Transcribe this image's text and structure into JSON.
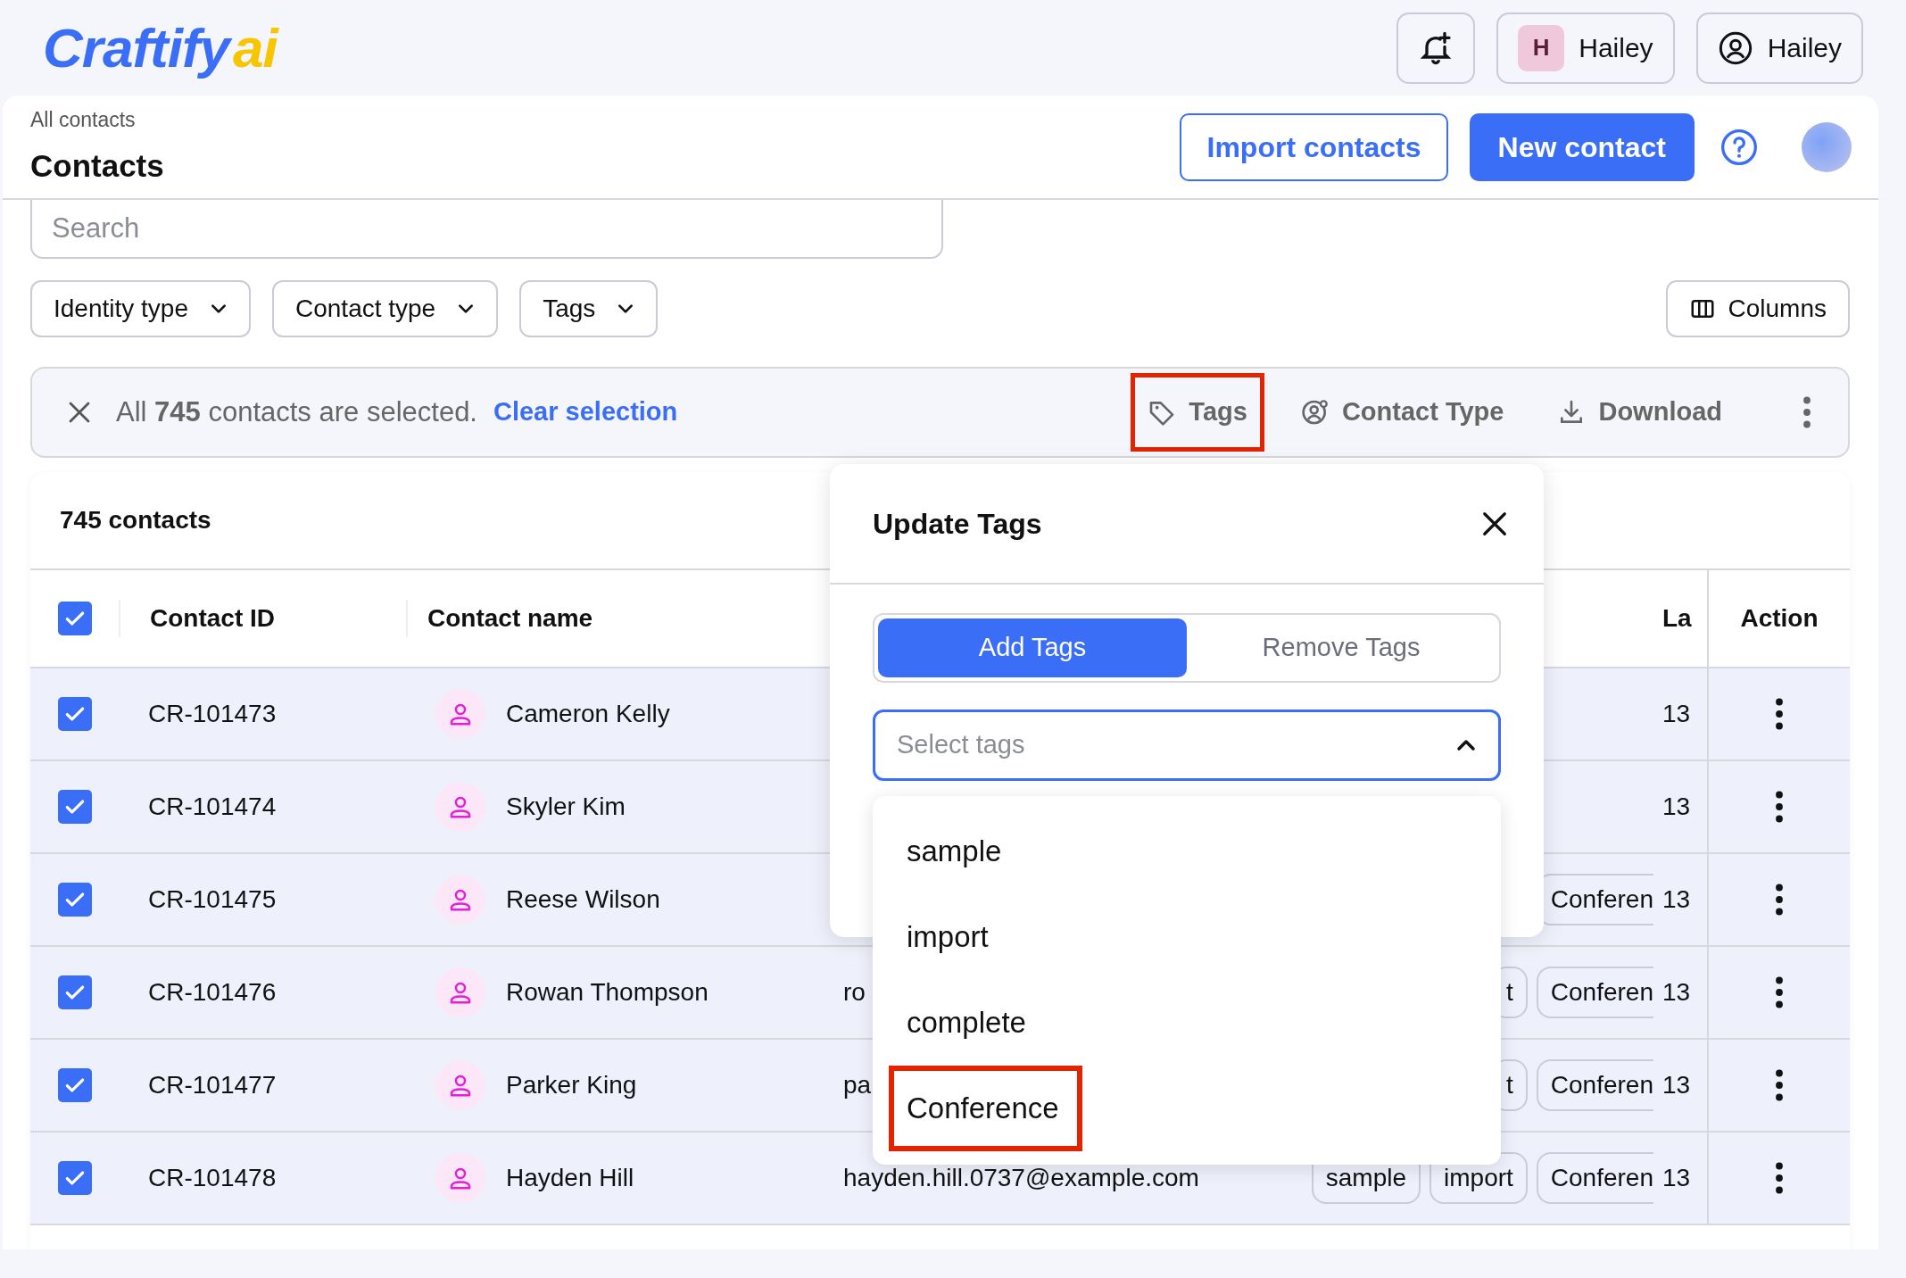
{
  "brand": {
    "name": "Craftify",
    "suffix": "ai"
  },
  "topbar": {
    "user_chip": {
      "initial": "H",
      "name": "Hailey"
    },
    "account": {
      "name": "Hailey"
    }
  },
  "header": {
    "breadcrumb": "All contacts",
    "title": "Contacts",
    "buttons": [
      {
        "label": "Import contacts",
        "kind": "outline"
      },
      {
        "label": "New contact",
        "kind": "primary"
      }
    ]
  },
  "search": {
    "placeholder": "Search"
  },
  "filters": [
    "Identity type",
    "Contact type",
    "Tags"
  ],
  "columns_button": "Columns",
  "selection_bar": {
    "text": "All **745** contacts are selected.",
    "link": "Clear selection",
    "actions": [
      {
        "label": "Tags",
        "kind": "tag",
        "highlighted": true
      },
      {
        "label": "Contact Type",
        "kind": "usergear",
        "highlighted": false
      },
      {
        "label": "Download",
        "kind": "download",
        "highlighted": false
      }
    ]
  },
  "table": {
    "title": "745 contacts",
    "all_checked": true,
    "columns": [
      "Contact ID",
      "Contact name",
      "La",
      "Action"
    ],
    "rows": [
      {
        "checked": true,
        "id": "CR-101473",
        "name": "Cameron Kelly",
        "last": "13"
      },
      {
        "checked": true,
        "id": "CR-101474",
        "name": "Skyler Kim",
        "last": "13"
      },
      {
        "checked": true,
        "id": "CR-101475",
        "name": "Reese Wilson",
        "tags": [
          "Conferen"
        ],
        "last": "13"
      },
      {
        "checked": true,
        "id": "CR-101476",
        "name": "Rowan Thompson",
        "email": "ro",
        "tags": [
          "t",
          "Conferen"
        ],
        "last": "13"
      },
      {
        "checked": true,
        "id": "CR-101477",
        "name": "Parker King",
        "email": "pa",
        "tags": [
          "t",
          "Conferen"
        ],
        "last": "13"
      },
      {
        "checked": true,
        "id": "CR-101478",
        "name": "Hayden Hill",
        "email": "hayden.hill.0737@example.com",
        "tags": [
          "sample",
          "import",
          "Conferen"
        ],
        "last": "13"
      }
    ]
  },
  "popover": {
    "title": "Update Tags",
    "tabs": [
      {
        "label": "Add Tags",
        "selected": true
      },
      {
        "label": "Remove Tags",
        "selected": false
      }
    ],
    "select": {
      "placeholder": "Select tags",
      "expanded": true
    },
    "options": [
      {
        "label": "sample",
        "highlighted": false
      },
      {
        "label": "import",
        "highlighted": false
      },
      {
        "label": "complete",
        "highlighted": false
      },
      {
        "label": "Conference",
        "highlighted": true
      }
    ]
  }
}
